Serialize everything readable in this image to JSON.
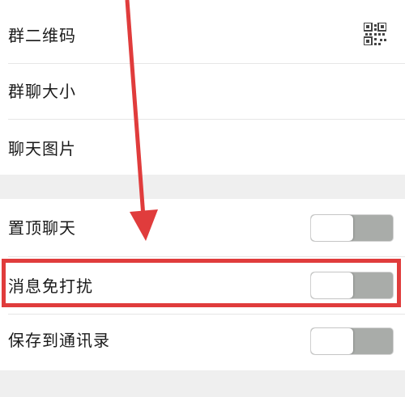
{
  "settings": {
    "group_qr_label": "群二维码",
    "group_size_label": "群聊大小",
    "chat_images_label": "聊天图片",
    "pin_chat_label": "置顶聊天",
    "mute_label": "消息免打扰",
    "save_contacts_label": "保存到通讯录"
  },
  "toggles": {
    "pin_chat_on": false,
    "mute_on": false,
    "save_contacts_on": false
  },
  "colors": {
    "highlight": "#e03c3c",
    "toggle_track": "#a9aca9",
    "section_gap": "#efefef"
  },
  "icons": {
    "qr": "qr-code-icon",
    "arrow": "red-arrow-annotation"
  }
}
